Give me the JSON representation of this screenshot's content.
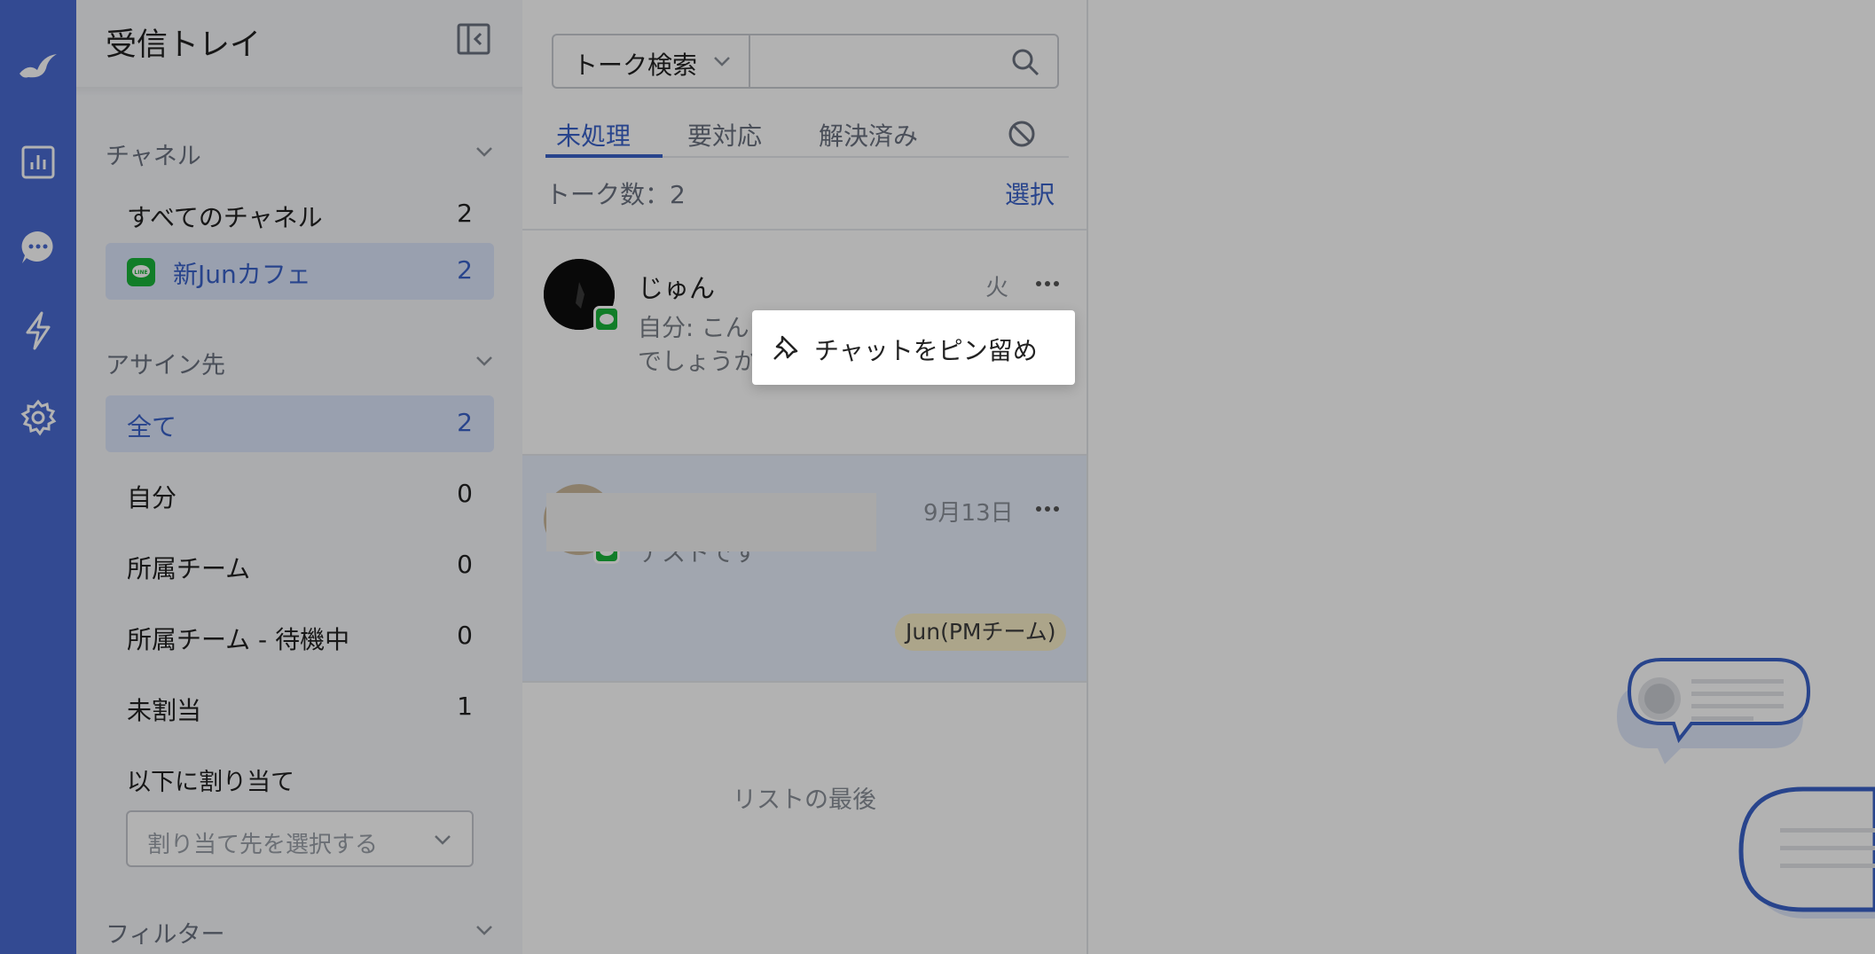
{
  "app": {
    "brand_color": "#4a6bd2",
    "accent_color": "#3a62c9",
    "line_color": "#19b33a"
  },
  "rail": {
    "icons": [
      "logo-icon",
      "analytics-icon",
      "chat-icon",
      "automation-icon",
      "settings-icon"
    ]
  },
  "sidebar": {
    "title": "受信トレイ",
    "channels": {
      "header": "チャネル",
      "items": [
        {
          "label": "すべてのチャネル",
          "count": "2"
        },
        {
          "label": "新Junカフェ",
          "count": "2"
        }
      ]
    },
    "assignee": {
      "header": "アサイン先",
      "items": [
        {
          "label": "全て",
          "count": "2"
        },
        {
          "label": "自分",
          "count": "0"
        },
        {
          "label": "所属チーム",
          "count": "0"
        },
        {
          "label": "所属チーム - 待機中",
          "count": "0"
        },
        {
          "label": "未割当",
          "count": "1"
        }
      ],
      "assign_label": "以下に割り当て",
      "assign_placeholder": "割り当て先を選択する"
    },
    "filter": {
      "header": "フィルター"
    }
  },
  "list": {
    "search_mode": "トーク検索",
    "search_value": "",
    "tabs": [
      "未処理",
      "要対応",
      "解決済み"
    ],
    "active_tab": "未処理",
    "count_text": "トーク数：2",
    "select_label": "選択",
    "conversations": [
      {
        "name": "じゅん",
        "time": "火",
        "preview": "自分: こん\nでしょうか"
      },
      {
        "name": "",
        "time": "9月13日",
        "preview": "テストです",
        "tag": "Jun(PMチーム)"
      }
    ],
    "end_text": "リストの最後"
  },
  "context_menu": {
    "items": [
      {
        "label": "チャットをピン留め",
        "icon": "pin-icon"
      }
    ]
  }
}
